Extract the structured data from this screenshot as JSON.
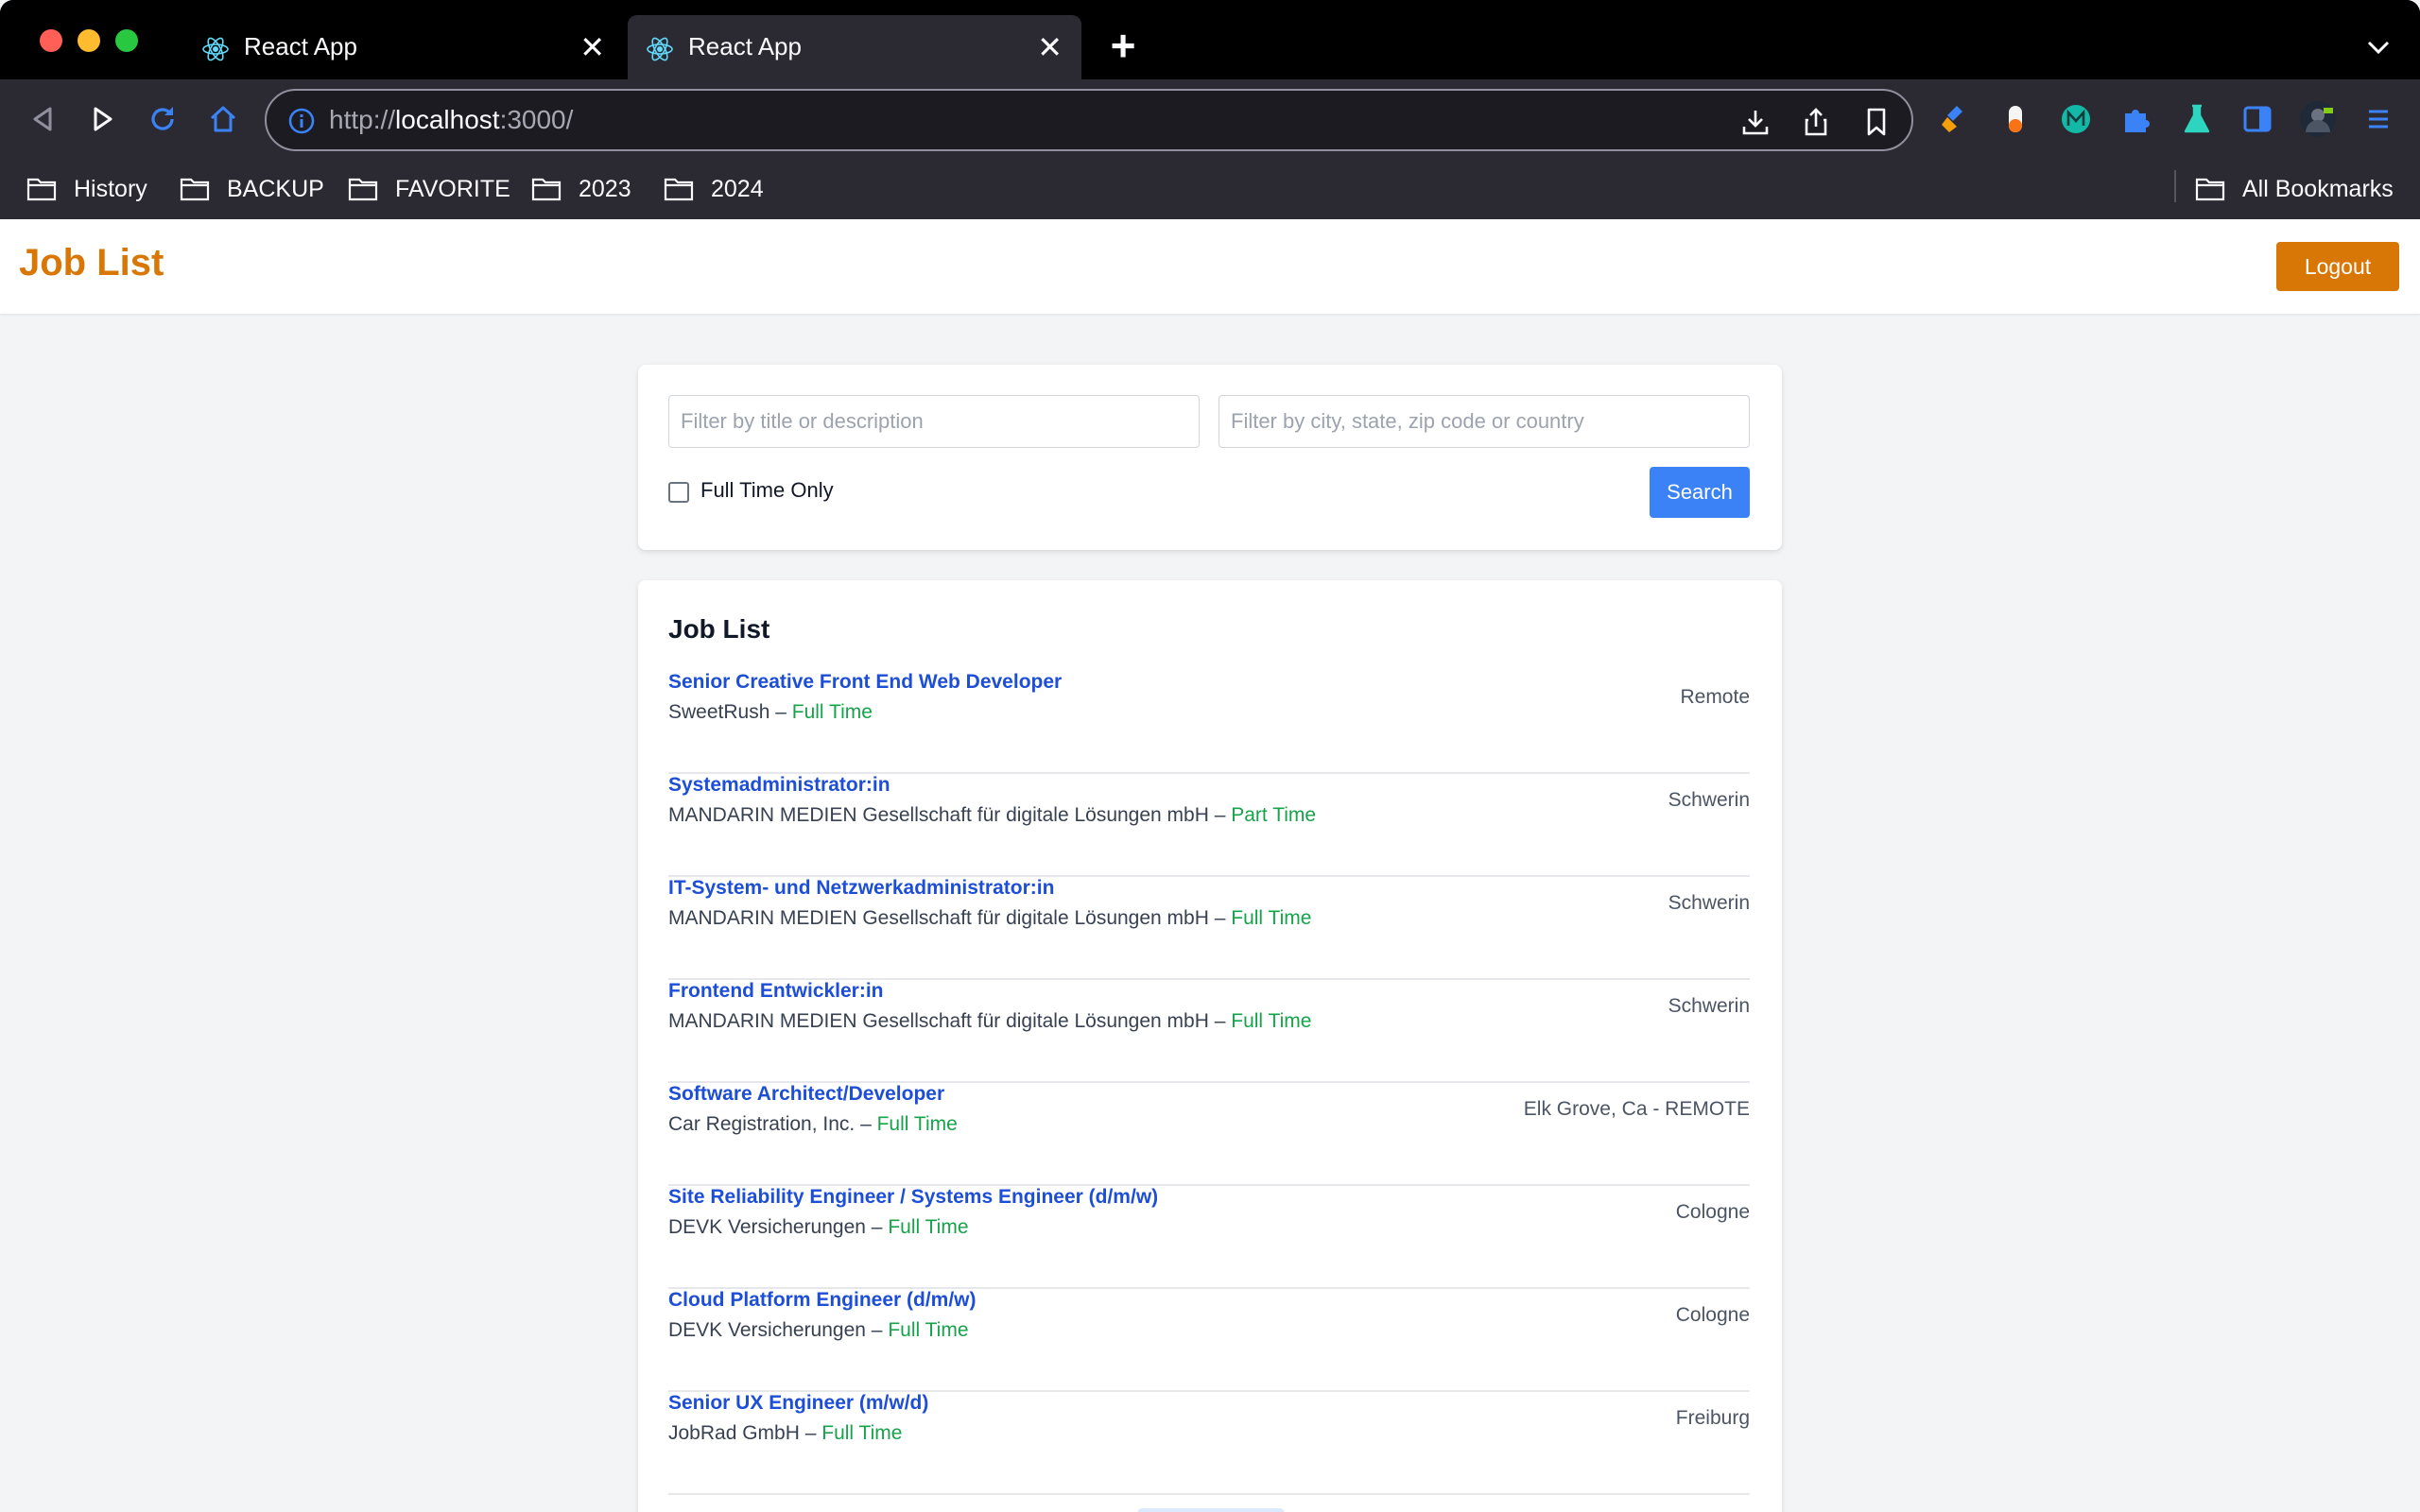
{
  "browser": {
    "tabs": [
      {
        "title": "React App",
        "active": false
      },
      {
        "title": "React App",
        "active": true
      }
    ],
    "url_scheme": "http://",
    "url_host": "localhost",
    "url_rest": ":3000/",
    "bookmarks": [
      "History",
      "BACKUP",
      "FAVORITE",
      "2023",
      "2024"
    ],
    "all_bookmarks": "All Bookmarks"
  },
  "header": {
    "title": "Job List",
    "logout_label": "Logout"
  },
  "filters": {
    "title_placeholder": "Filter by title or description",
    "location_placeholder": "Filter by city, state, zip code or country",
    "fulltime_label": "Full Time Only",
    "fulltime_checked": false,
    "search_label": "Search"
  },
  "job_list": {
    "title": "Job List",
    "jobs": [
      {
        "title": "Senior Creative Front End Web Developer",
        "company": "SweetRush",
        "type": "Full Time",
        "location": "Remote"
      },
      {
        "title": "Systemadministrator:in",
        "company": "MANDARIN MEDIEN Gesellschaft für digitale Lösungen mbH",
        "type": "Part Time",
        "location": "Schwerin"
      },
      {
        "title": "IT-System- und Netzwerkadministrator:in",
        "company": "MANDARIN MEDIEN Gesellschaft für digitale Lösungen mbH",
        "type": "Full Time",
        "location": "Schwerin"
      },
      {
        "title": "Frontend Entwickler:in",
        "company": "MANDARIN MEDIEN Gesellschaft für digitale Lösungen mbH",
        "type": "Full Time",
        "location": "Schwerin"
      },
      {
        "title": "Software Architect/Developer",
        "company": "Car Registration, Inc.",
        "type": "Full Time",
        "location": "Elk Grove, Ca - REMOTE"
      },
      {
        "title": "Site Reliability Engineer / Systems Engineer (d/m/w)",
        "company": "DEVK Versicherungen",
        "type": "Full Time",
        "location": "Cologne"
      },
      {
        "title": "Cloud Platform Engineer (d/m/w)",
        "company": "DEVK Versicherungen",
        "type": "Full Time",
        "location": "Cologne"
      },
      {
        "title": "Senior UX Engineer (m/w/d)",
        "company": "JobRad GmbH",
        "type": "Full Time",
        "location": "Freiburg"
      }
    ]
  },
  "colors": {
    "accent": "#d97706",
    "link": "#1d4ed8",
    "job_type": "#16a34a",
    "search_button": "#3b82f6"
  }
}
